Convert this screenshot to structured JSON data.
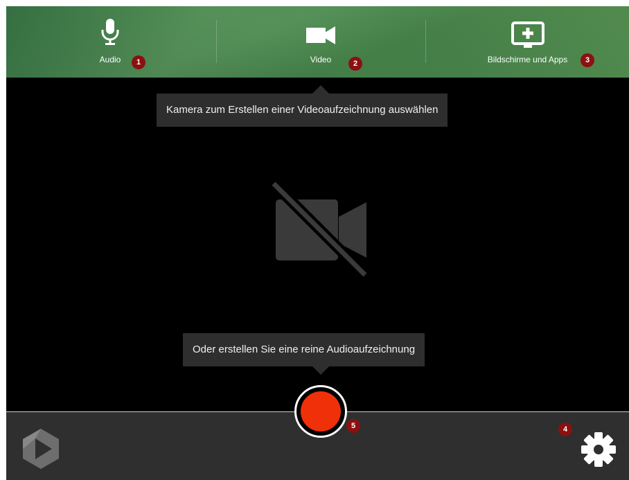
{
  "source_tabs": {
    "audio": {
      "label": "Audio",
      "badge": "1",
      "icon": "microphone-icon"
    },
    "video": {
      "label": "Video",
      "badge": "2",
      "icon": "video-camera-icon"
    },
    "screens": {
      "label": "Bildschirme und Apps",
      "badge": "3",
      "icon": "add-screen-icon"
    }
  },
  "tooltips": {
    "camera": "Kamera zum Erstellen einer Videoaufzeichnung auswählen",
    "audio_only": "Oder erstellen Sie eine reine Audioaufzeichnung"
  },
  "preview": {
    "icon": "video-off-icon"
  },
  "controls": {
    "record_badge": "5",
    "settings_badge": "4",
    "record_icon": "record-icon",
    "settings_icon": "gear-icon",
    "logo_icon": "panopto-logo-icon"
  },
  "colors": {
    "header_green": "#4a8a4e",
    "record_red": "#f03008",
    "badge_red": "#8b1010",
    "bottom_bar": "#2f2f2f",
    "tooltip_bg": "#2e2e2e"
  }
}
